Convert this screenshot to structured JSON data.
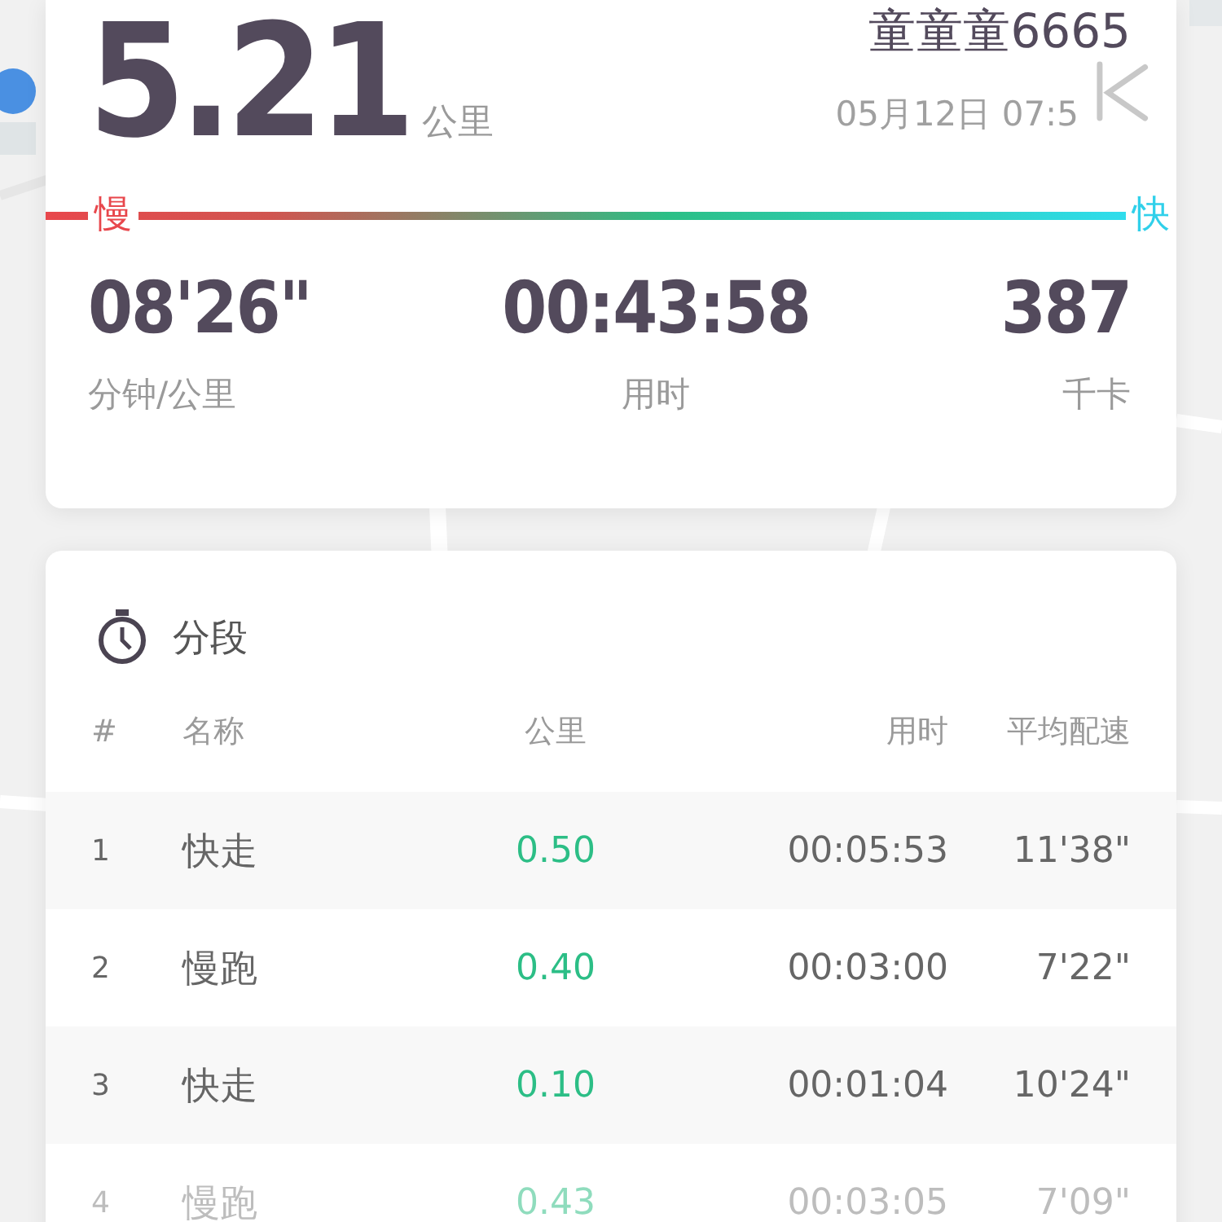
{
  "summary": {
    "distance": "5.21",
    "unit": "公里",
    "user": "童童童6665",
    "date": "05月12日 07:5",
    "slow_label": "慢",
    "fast_label": "快",
    "stats": [
      {
        "value": "08'26\"",
        "label": "分钟/公里"
      },
      {
        "value": "00:43:58",
        "label": "用时"
      },
      {
        "value": "387",
        "label": "千卡"
      }
    ]
  },
  "splits": {
    "title": "分段",
    "columns": [
      "#",
      "名称",
      "公里",
      "用时",
      "平均配速"
    ],
    "rows": [
      {
        "index": "1",
        "name": "快走",
        "km": "0.50",
        "time": "00:05:53",
        "pace": "11'38\""
      },
      {
        "index": "2",
        "name": "慢跑",
        "km": "0.40",
        "time": "00:03:00",
        "pace": "7'22\""
      },
      {
        "index": "3",
        "name": "快走",
        "km": "0.10",
        "time": "00:01:04",
        "pace": "10'24\""
      },
      {
        "index": "4",
        "name": "慢跑",
        "km": "0.43",
        "time": "00:03:05",
        "pace": "7'09\""
      }
    ]
  }
}
